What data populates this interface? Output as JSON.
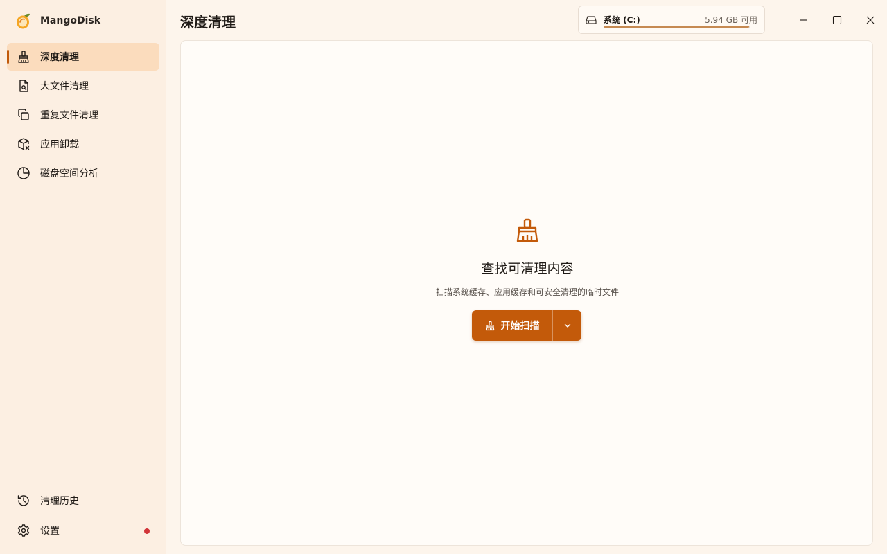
{
  "app": {
    "name": "MangoDisk"
  },
  "sidebar": {
    "items": [
      {
        "label": "深度清理",
        "icon": "broom-icon",
        "active": true
      },
      {
        "label": "大文件清理",
        "icon": "file-search-icon"
      },
      {
        "label": "重复文件清理",
        "icon": "copy-icon"
      },
      {
        "label": "应用卸载",
        "icon": "package-remove-icon"
      },
      {
        "label": "磁盘空间分析",
        "icon": "pie-chart-icon"
      }
    ],
    "bottom_items": [
      {
        "label": "清理历史",
        "icon": "history-icon"
      },
      {
        "label": "设置",
        "icon": "gear-icon",
        "badge": "notification-dot"
      }
    ]
  },
  "header": {
    "title": "深度清理"
  },
  "drive": {
    "name": "系统 (C:)",
    "free": "5.94 GB 可用",
    "usage_fraction": 0.99,
    "icon": "drive-icon"
  },
  "window_controls": [
    "minimize-icon",
    "maximize-icon",
    "close-icon"
  ],
  "empty_state": {
    "icon": "broom-icon",
    "title": "查找可清理内容",
    "description": "扫描系统缓存、应用缓存和可安全清理的临时文件"
  },
  "scan_button": {
    "label": "开始扫描",
    "icon": "broom-icon",
    "dropdown_icon": "chevron-down-icon"
  },
  "colors": {
    "accent": "#c35a0a",
    "active_bg": "#fbdcbd",
    "badge": "#d13438"
  }
}
